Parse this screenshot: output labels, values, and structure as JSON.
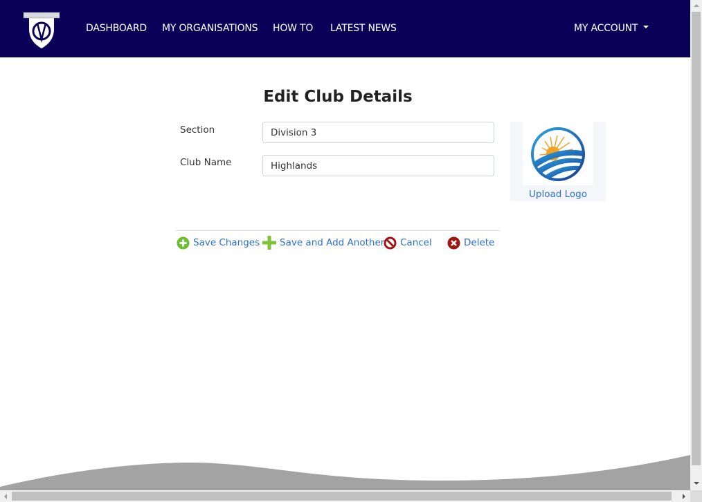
{
  "navbar": {
    "logo_alt": "club-crest-logo",
    "items": [
      {
        "label": "DASHBOARD"
      },
      {
        "label": "MY ORGANISATIONS"
      },
      {
        "label": "HOW TO"
      },
      {
        "label": "LATEST NEWS"
      }
    ],
    "account_label": "MY ACCOUNT"
  },
  "page": {
    "title": "Edit Club Details"
  },
  "form": {
    "section": {
      "label": "Section",
      "value": "Division 3"
    },
    "club_name": {
      "label": "Club Name",
      "value": "Highlands"
    }
  },
  "logo_panel": {
    "upload_label": "Upload Logo"
  },
  "actions": {
    "save": "Save Changes",
    "save_add": "Save and Add Another",
    "cancel": "Cancel",
    "delete": "Delete"
  },
  "colors": {
    "navbar": "#0a0058",
    "link": "#2a6fd6",
    "save_icon": "#6cbf2f",
    "danger_icon": "#a01616"
  }
}
